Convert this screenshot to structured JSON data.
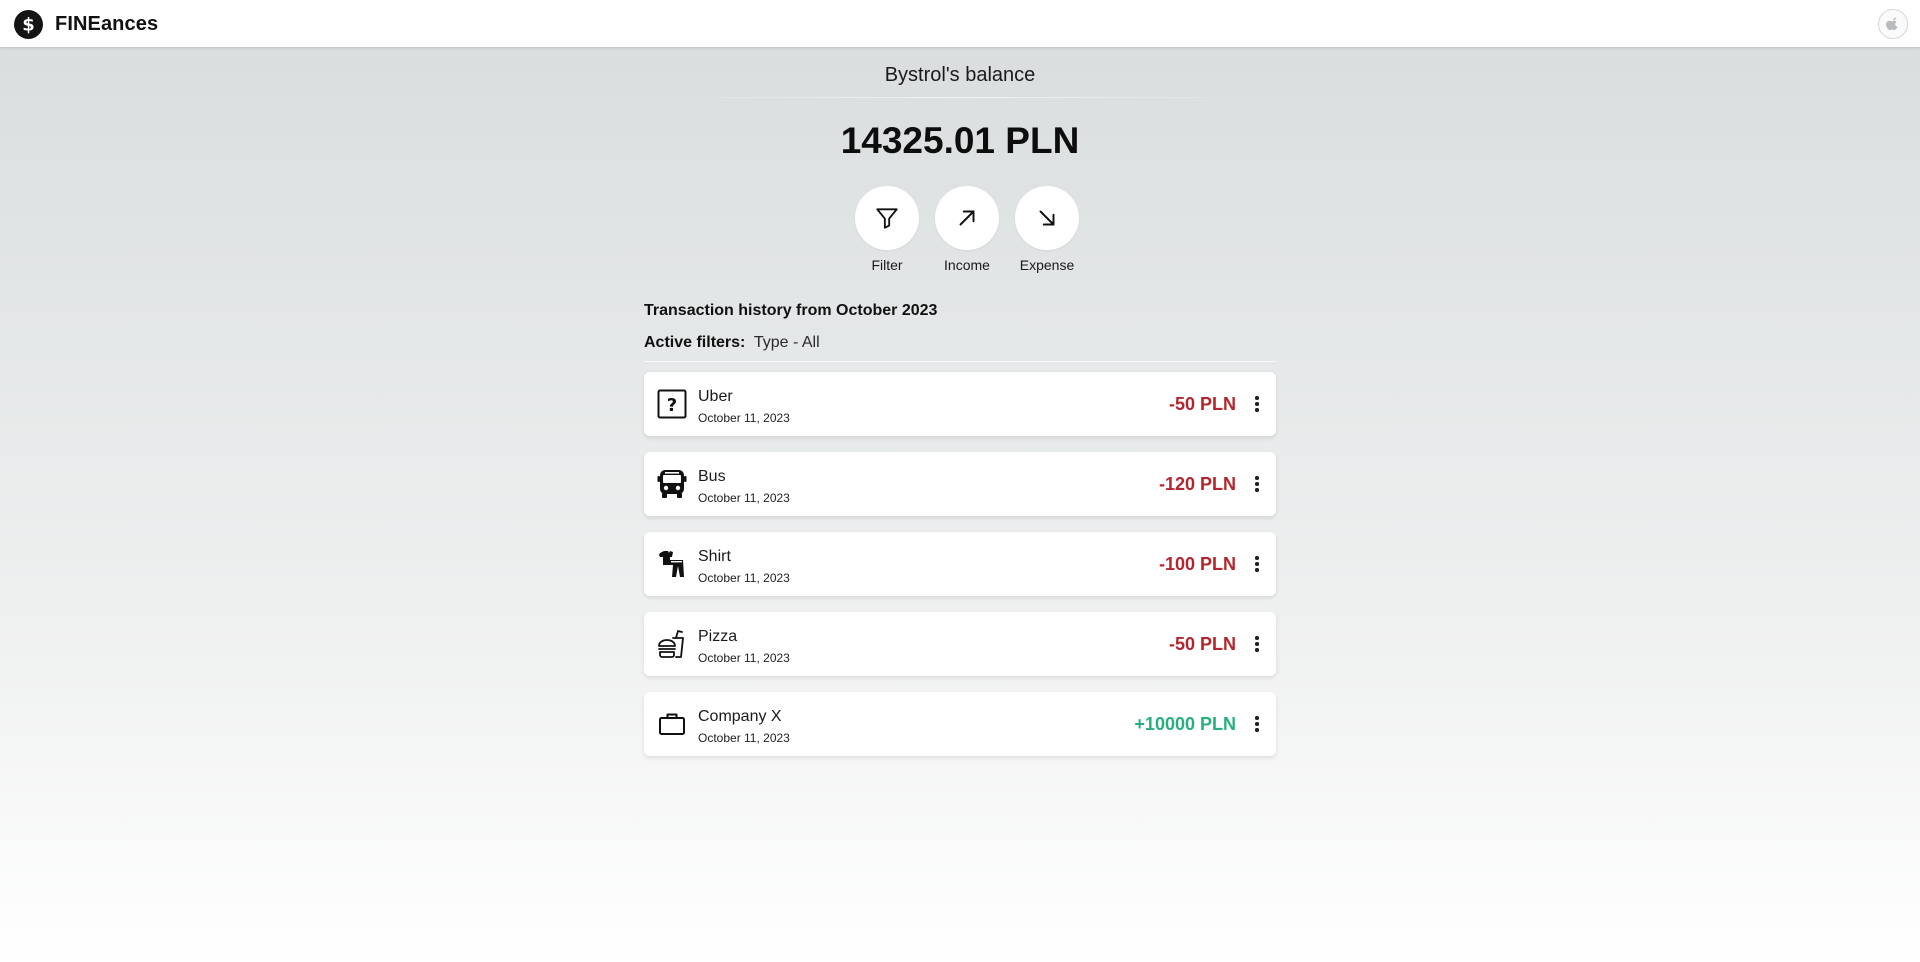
{
  "app": {
    "title": "FINEances",
    "logo_icon": "dollar-circle-icon",
    "avatar_icon": "apple-icon"
  },
  "balance": {
    "label": "Bystrol's balance",
    "amount": "14325.01 PLN"
  },
  "actions": [
    {
      "label": "Filter",
      "icon": "filter-icon"
    },
    {
      "label": "Income",
      "icon": "arrow-up-right-icon"
    },
    {
      "label": "Expense",
      "icon": "arrow-down-right-icon"
    }
  ],
  "history": {
    "title": "Transaction history from October 2023",
    "filters_label": "Active filters:",
    "filters_value": "Type - All"
  },
  "transactions": [
    {
      "name": "Uber",
      "date": "October 11, 2023",
      "amount": "-50 PLN",
      "type": "expense",
      "icon": "question-box-icon"
    },
    {
      "name": "Bus",
      "date": "October 11, 2023",
      "amount": "-120 PLN",
      "type": "expense",
      "icon": "bus-icon"
    },
    {
      "name": "Shirt",
      "date": "October 11, 2023",
      "amount": "-100 PLN",
      "type": "expense",
      "icon": "clothes-icon"
    },
    {
      "name": "Pizza",
      "date": "October 11, 2023",
      "amount": "-50 PLN",
      "type": "expense",
      "icon": "fast-food-icon"
    },
    {
      "name": "Company X",
      "date": "October 11, 2023",
      "amount": "+10000 PLN",
      "type": "income",
      "icon": "briefcase-icon"
    }
  ],
  "colors": {
    "expense": "#b3262d",
    "income": "#27b07c"
  }
}
